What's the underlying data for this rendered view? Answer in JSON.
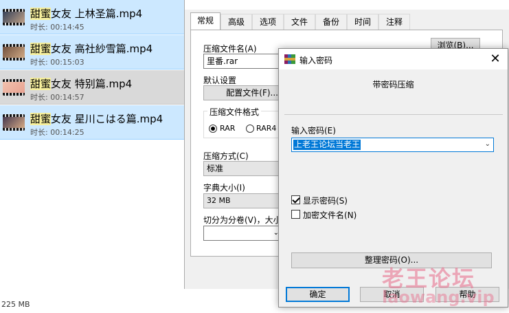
{
  "file_list": {
    "items": [
      {
        "highlight": "甜蜜",
        "name": "女友 上林圣篇.mp4",
        "duration": "时长: 00:14:45",
        "thumb_colors": [
          "#2b3a55",
          "#c9a88a"
        ],
        "selected": false
      },
      {
        "highlight": "甜蜜",
        "name": "女友 高社紗雪篇.mp4",
        "duration": "时长: 00:15:03",
        "thumb_colors": [
          "#6a4a3a",
          "#d7b089"
        ],
        "selected": false
      },
      {
        "highlight": "甜蜜",
        "name": "女友 特别篇.mp4",
        "duration": "时长: 00:14:57",
        "thumb_colors": [
          "#f2c4b0",
          "#e8a090"
        ],
        "selected": true
      },
      {
        "highlight": "甜蜜",
        "name": "女友 星川こはる篇.mp4",
        "duration": "时长: 00:14:25",
        "thumb_colors": [
          "#3a2f4a",
          "#e0b38a"
        ],
        "selected": false
      }
    ],
    "status_size": "225 MB"
  },
  "archive_dialog": {
    "tabs": [
      "常规",
      "高级",
      "选项",
      "文件",
      "备份",
      "时间",
      "注释"
    ],
    "active_tab": "常规",
    "archive_name_label": "压缩文件名(A)",
    "archive_name_value": "里番.rar",
    "browse_button": "浏览(B)...",
    "default_settings_label": "默认设置",
    "profiles_button": "配置文件(F)...",
    "format_group_label": "压缩文件格式",
    "format_options": [
      "RAR",
      "RAR4"
    ],
    "format_selected": "RAR",
    "method_label": "压缩方式(C)",
    "method_value": "标准",
    "dict_label": "字典大小(I)",
    "dict_value": "32 MB",
    "split_label": "切分为分卷(V)，大小"
  },
  "password_dialog": {
    "title": "输入密码",
    "heading": "带密码压缩",
    "input_label": "输入密码(E)",
    "input_value": "上老王论坛当老王",
    "show_password_label": "显示密码(S)",
    "show_password_checked": true,
    "encrypt_names_label": "加密文件名(N)",
    "encrypt_names_checked": false,
    "organize_button": "整理密码(O)...",
    "ok_button": "确定",
    "cancel_button": "取消",
    "help_button": "帮助",
    "close_icon": "close-icon",
    "accent_color": "#0078d7"
  },
  "watermark": {
    "cn": "老王论坛",
    "en": "laowang.vip"
  }
}
